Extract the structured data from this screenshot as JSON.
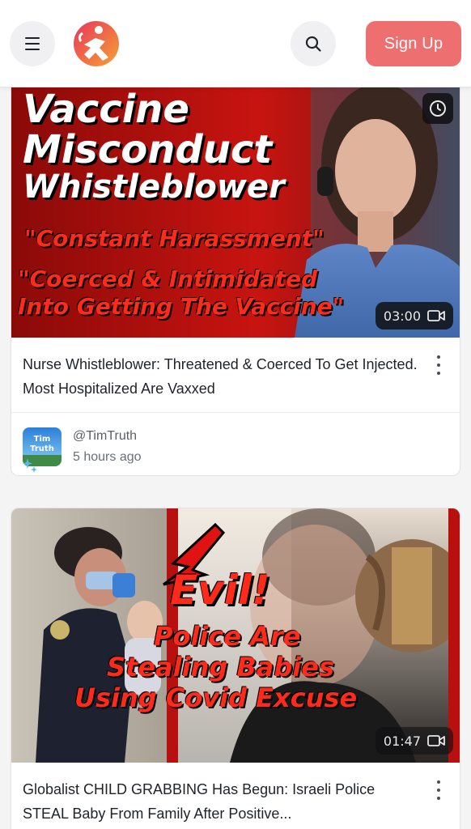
{
  "header": {
    "menu_icon": "hamburger-menu-icon",
    "logo_icon": "brand-logo-icon",
    "search_icon": "search-icon",
    "signup_label": "Sign Up",
    "accent_color": "#ee6f6f"
  },
  "posts": [
    {
      "thumbnail_lines": [
        "Vaccine",
        "Misconduct",
        "Whistleblower"
      ],
      "thumbnail_quote1": "\"Constant Harassment\"",
      "thumbnail_quote2a": "\"Coerced & Intimidated",
      "thumbnail_quote2b": "Into Getting The Vaccine\"",
      "duration": "03:00",
      "title": "Nurse Whistleblower: Threatened & Coerced To Get Injected. Most Hospitalized Are Vaxxed",
      "author_handle": "@TimTruth",
      "avatar_text_1": "Tim",
      "avatar_text_2": "Truth",
      "posted": "5 hours ago"
    },
    {
      "thumbnail_line1": "Evil!",
      "thumbnail_line2": "Police Are",
      "thumbnail_line3": "Stealing Babies",
      "thumbnail_line4": "Using Covid Excuse",
      "duration": "01:47",
      "title": "Globalist CHILD GRABBING Has Begun: Israeli Police STEAL Baby From Family After Positive..."
    }
  ]
}
